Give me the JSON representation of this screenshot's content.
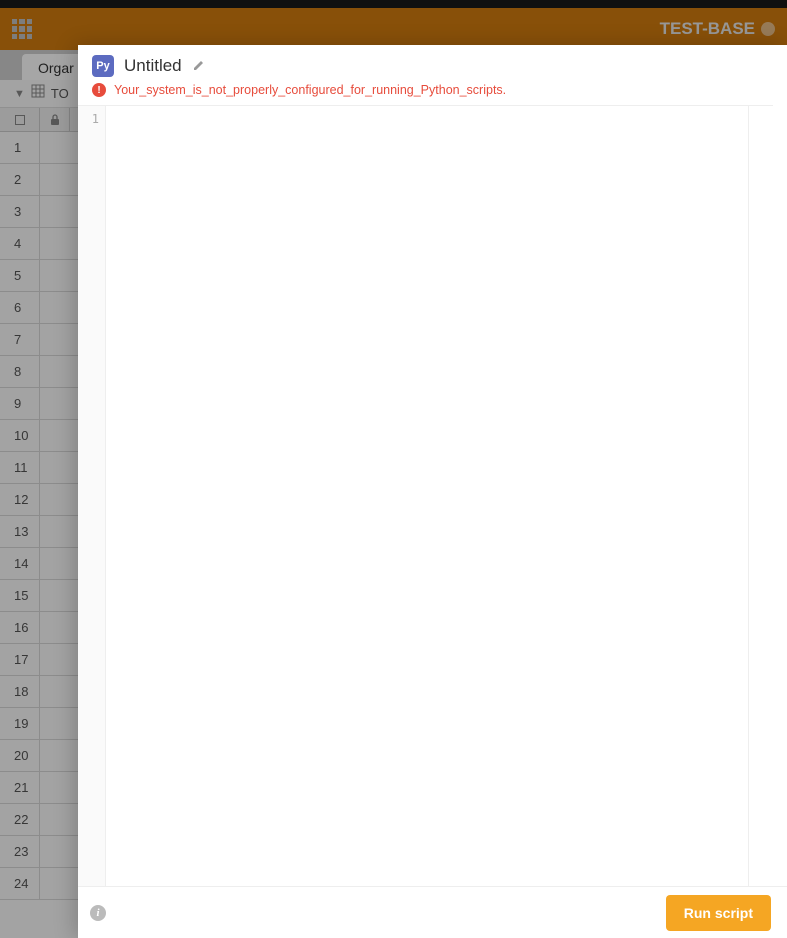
{
  "header": {
    "project_name": "TEST-BASE"
  },
  "tabs": {
    "active_tab_label": "Orgar"
  },
  "subheader": {
    "table_label": "TO"
  },
  "spreadsheet": {
    "row_numbers": [
      "1",
      "2",
      "3",
      "4",
      "5",
      "6",
      "7",
      "8",
      "9",
      "10",
      "11",
      "12",
      "13",
      "14",
      "15",
      "16",
      "17",
      "18",
      "19",
      "20",
      "21",
      "22",
      "23",
      "24"
    ]
  },
  "modal": {
    "badge": "Py",
    "title": "Untitled",
    "error_message": "Your_system_is_not_properly_configured_for_running_Python_scripts.",
    "gutter_line": "1",
    "run_button_label": "Run script"
  }
}
